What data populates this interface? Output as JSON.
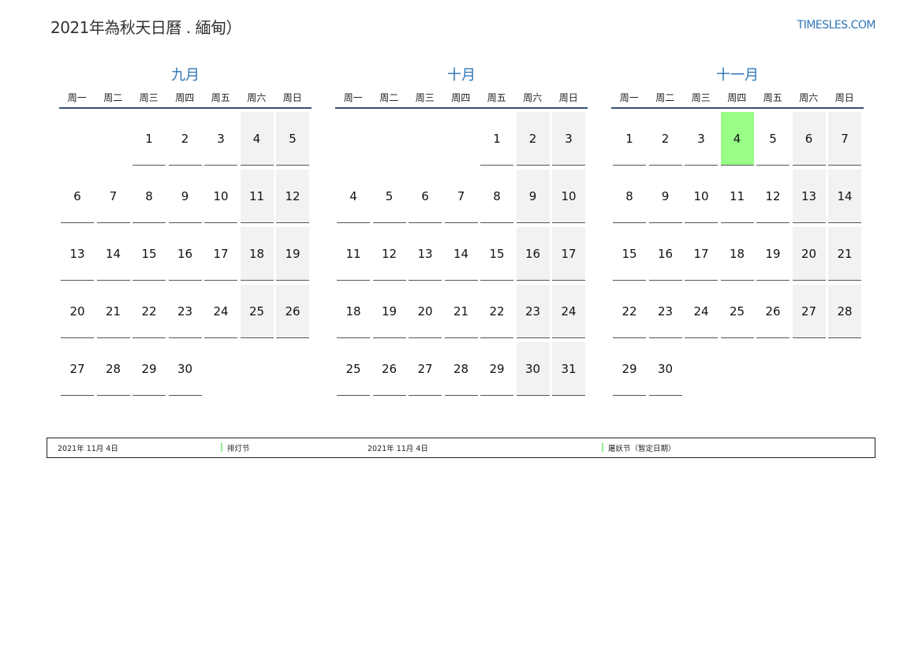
{
  "header": {
    "title": "2021年為秋天日曆 . 緬甸）",
    "site": "TIMESLES.COM"
  },
  "weekdays": [
    "周一",
    "周二",
    "周三",
    "周四",
    "周五",
    "周六",
    "周日"
  ],
  "months": [
    {
      "name": "九月",
      "weeks": [
        [
          "",
          "",
          "1",
          "2",
          "3",
          "4",
          "5"
        ],
        [
          "6",
          "7",
          "8",
          "9",
          "10",
          "11",
          "12"
        ],
        [
          "13",
          "14",
          "15",
          "16",
          "17",
          "18",
          "19"
        ],
        [
          "20",
          "21",
          "22",
          "23",
          "24",
          "25",
          "26"
        ],
        [
          "27",
          "28",
          "29",
          "30",
          "",
          "",
          ""
        ]
      ]
    },
    {
      "name": "十月",
      "weeks": [
        [
          "",
          "",
          "",
          "",
          "1",
          "2",
          "3"
        ],
        [
          "4",
          "5",
          "6",
          "7",
          "8",
          "9",
          "10"
        ],
        [
          "11",
          "12",
          "13",
          "14",
          "15",
          "16",
          "17"
        ],
        [
          "18",
          "19",
          "20",
          "21",
          "22",
          "23",
          "24"
        ],
        [
          "25",
          "26",
          "27",
          "28",
          "29",
          "30",
          "31"
        ]
      ]
    },
    {
      "name": "十一月",
      "weeks": [
        [
          "1",
          "2",
          "3",
          "4",
          "5",
          "6",
          "7"
        ],
        [
          "8",
          "9",
          "10",
          "11",
          "12",
          "13",
          "14"
        ],
        [
          "15",
          "16",
          "17",
          "18",
          "19",
          "20",
          "21"
        ],
        [
          "22",
          "23",
          "24",
          "25",
          "26",
          "27",
          "28"
        ],
        [
          "29",
          "30",
          "",
          "",
          "",
          "",
          ""
        ]
      ],
      "highlight": "4"
    }
  ],
  "colors": {
    "accent": "#2e75b6",
    "weekend_bg": "#f2f2f2",
    "holiday_bg": "#99ff88"
  },
  "legend": [
    {
      "date": "2021年 11月 4日",
      "name": "排灯节"
    },
    {
      "date": "2021年 11月 4日",
      "name": "屠妖节（暂定日期）"
    }
  ]
}
